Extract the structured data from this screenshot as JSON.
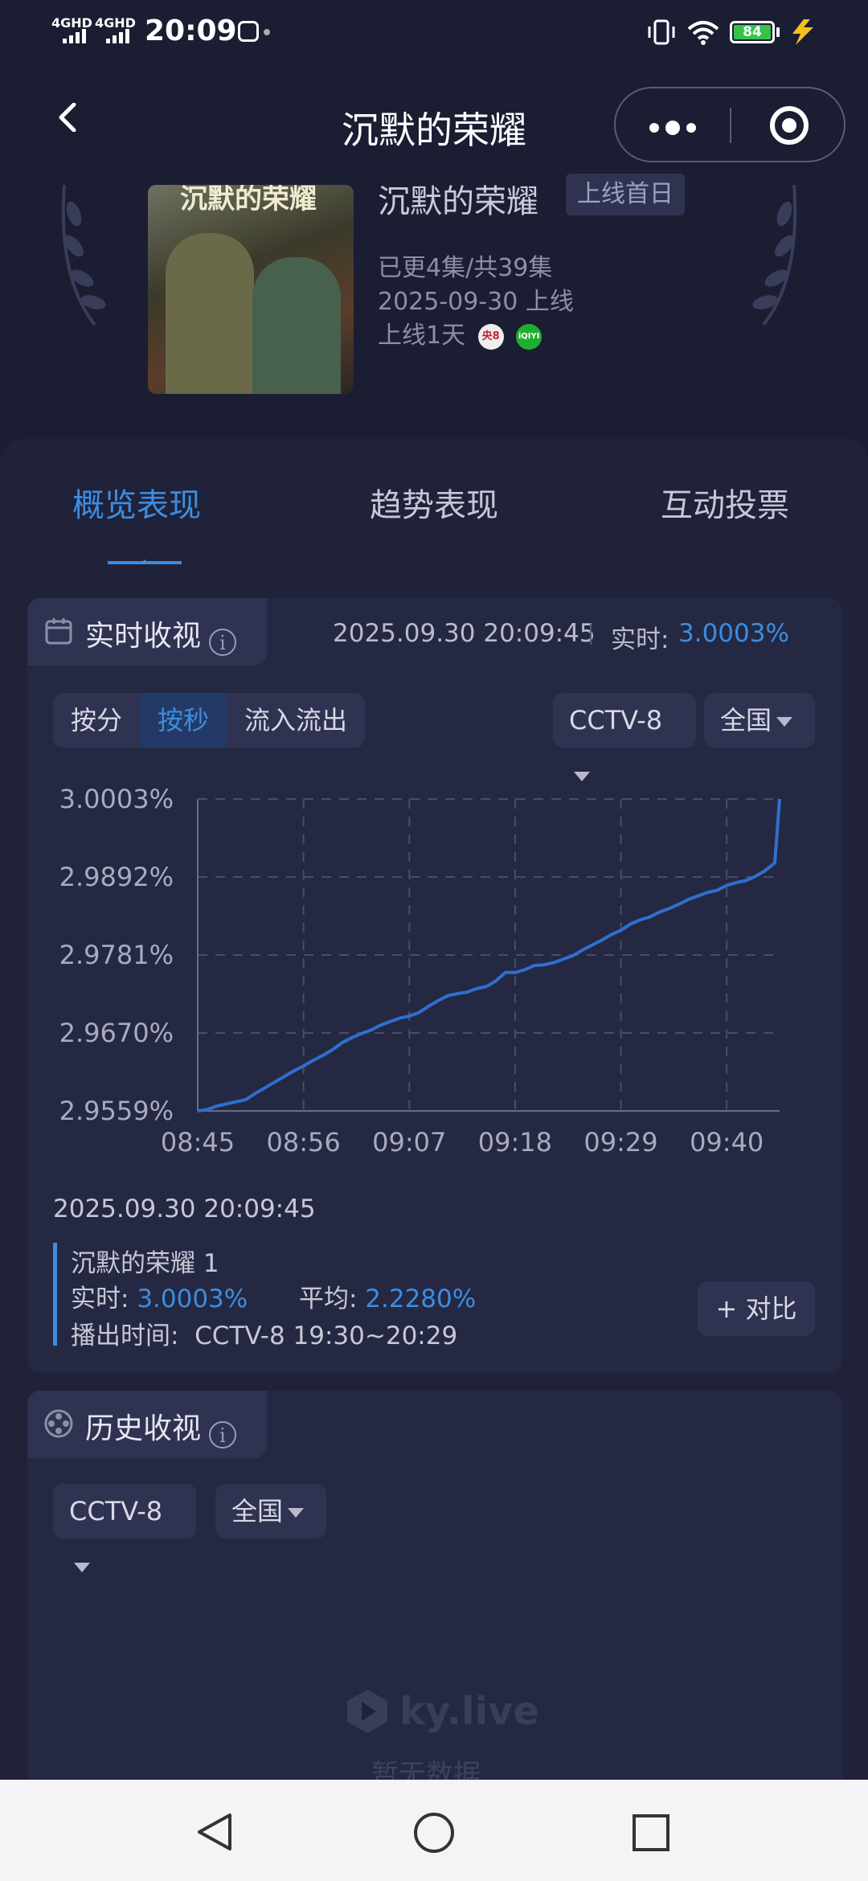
{
  "status_bar": {
    "network1": "4GHD",
    "network2": "4GHD",
    "time": "20:09",
    "battery": "84"
  },
  "nav": {
    "title": "沉默的荣耀"
  },
  "show": {
    "poster_text": "沉默的荣耀",
    "name": "沉默的荣耀",
    "badge": "上线首日",
    "episodes": "已更4集/共39集",
    "release": "2025-09-30 上线",
    "online_days": "上线1天",
    "channel_icons": [
      "央8",
      "iQIYI"
    ]
  },
  "tabs": [
    {
      "label": "概览表现",
      "active": true
    },
    {
      "label": "趋势表现",
      "active": false
    },
    {
      "label": "互动投票",
      "active": false
    }
  ],
  "realtime": {
    "label": "实时收视",
    "timestamp": "2025.09.30 20:09:45",
    "rt_label": "实时:",
    "rt_value": "3.0003%",
    "segments": [
      "按分",
      "按秒",
      "流入流出"
    ],
    "active_segment": "按秒",
    "channel": "CCTV-8",
    "region": "全国"
  },
  "chart_data": {
    "type": "line",
    "title": "",
    "xlabel": "",
    "ylabel": "",
    "x_ticks": [
      "08:45",
      "08:56",
      "09:07",
      "09:18",
      "09:29",
      "09:40"
    ],
    "y_ticks": [
      "3.0003%",
      "2.9892%",
      "2.9781%",
      "2.9670%",
      "2.9559%"
    ],
    "ylim": [
      2.9559,
      3.0003
    ],
    "grid": true,
    "series": [
      {
        "color": "#2f6fcf",
        "x": [
          "08:45",
          "08:46",
          "08:47",
          "08:48",
          "08:49",
          "08:50",
          "08:51",
          "08:52",
          "08:53",
          "08:54",
          "08:55",
          "08:56",
          "08:57",
          "08:58",
          "08:59",
          "09:00",
          "09:01",
          "09:02",
          "09:03",
          "09:04",
          "09:05",
          "09:06",
          "09:07",
          "09:08",
          "09:09",
          "09:10",
          "09:11",
          "09:12",
          "09:13",
          "09:14",
          "09:15",
          "09:16",
          "09:17",
          "09:18",
          "09:19",
          "09:20",
          "09:21",
          "09:22",
          "09:23",
          "09:24",
          "09:25",
          "09:26",
          "09:27",
          "09:28",
          "09:29",
          "09:30",
          "09:31",
          "09:32",
          "09:33",
          "09:34",
          "09:35",
          "09:36",
          "09:37",
          "09:38",
          "09:39",
          "09:40",
          "09:41",
          "09:42",
          "09:43",
          "09:44",
          "09:45"
        ],
        "values": [
          2.9559,
          2.9561,
          2.9566,
          2.9569,
          2.9572,
          2.9575,
          2.9584,
          2.9592,
          2.96,
          2.9608,
          2.9616,
          2.9623,
          2.9631,
          2.9638,
          2.9646,
          2.9656,
          2.9663,
          2.9669,
          2.9674,
          2.9681,
          2.9686,
          2.9691,
          2.9694,
          2.9699,
          2.9708,
          2.9716,
          2.9723,
          2.9726,
          2.9728,
          2.9733,
          2.9736,
          2.9744,
          2.9756,
          2.9756,
          2.976,
          2.9766,
          2.9767,
          2.977,
          2.9775,
          2.978,
          2.9788,
          2.9795,
          2.9802,
          2.981,
          2.9816,
          2.9825,
          2.9831,
          2.9835,
          2.9842,
          2.9847,
          2.9853,
          2.986,
          2.9865,
          2.987,
          2.9873,
          2.988,
          2.9884,
          2.9887,
          2.9893,
          2.9901,
          2.9912
        ]
      }
    ]
  },
  "detail": {
    "timestamp": "2025.09.30 20:09:45",
    "program": "沉默的荣耀 1",
    "rt_label": "实时:",
    "rt_value": "3.0003%",
    "avg_label": "平均:",
    "avg_value": "2.2280%",
    "airtime": "播出时间:  CCTV-8 19:30~20:29",
    "compare": "+ 对比"
  },
  "history": {
    "label": "历史收视",
    "channel": "CCTV-8",
    "region": "全国",
    "watermark": "ky.live",
    "empty": "暂无数据"
  },
  "colors": {
    "background": "#1b1d33",
    "card": "#20223a",
    "accent": "#3b8de0",
    "line": "#2f6fcf"
  }
}
